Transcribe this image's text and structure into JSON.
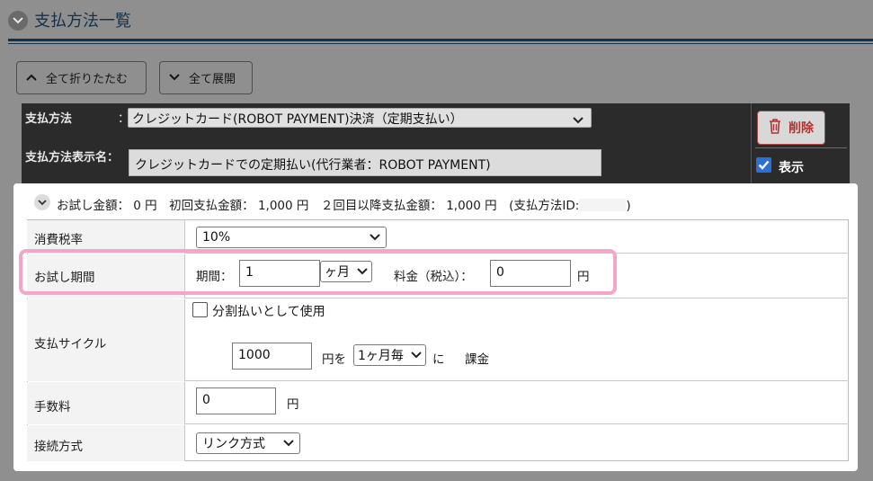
{
  "header": {
    "title": "支払方法一覧"
  },
  "toolbar": {
    "collapse_all": "全て折りたたむ",
    "expand_all": "全て展開"
  },
  "payment": {
    "method_label": "支払方法",
    "method_colon": "：",
    "method_value": "クレジットカード(ROBOT PAYMENT)決済（定期支払い）",
    "display_name_label": "支払方法表示名：",
    "display_name_value": "クレジットカードでの定期払い(代行業者：ROBOT PAYMENT)",
    "delete_label": "削除",
    "show_label": "表示",
    "show_checked": true
  },
  "summary": {
    "text_before": "お試し金額： 0 円　初回支払金額： 1,000 円　２回目以降支払金額： 1,000 円　(支払方法ID:",
    "text_after": ")"
  },
  "form": {
    "tax": {
      "label": "消費税率",
      "value": "10%"
    },
    "trial": {
      "label": "お試し期間",
      "period_label": "期間：",
      "period_value": "1",
      "unit_value": "ヶ月",
      "fee_label": "料金（税込）：",
      "fee_value": "0",
      "fee_unit": "円"
    },
    "cycle": {
      "label": "支払サイクル",
      "installment_label": "分割払いとして使用",
      "amount_value": "1000",
      "amount_unit": "円を",
      "interval_value": "1ヶ月毎",
      "ni": "に",
      "charge": "課金"
    },
    "fee": {
      "label": "手数料",
      "value": "0",
      "unit": "円"
    },
    "connection": {
      "label": "接続方式",
      "value": "リンク方式"
    }
  },
  "colors": {
    "highlight": "#f4a6c8",
    "header_text": "#15304a",
    "delete": "#b03434",
    "checkbox": "#2c6fd6"
  }
}
